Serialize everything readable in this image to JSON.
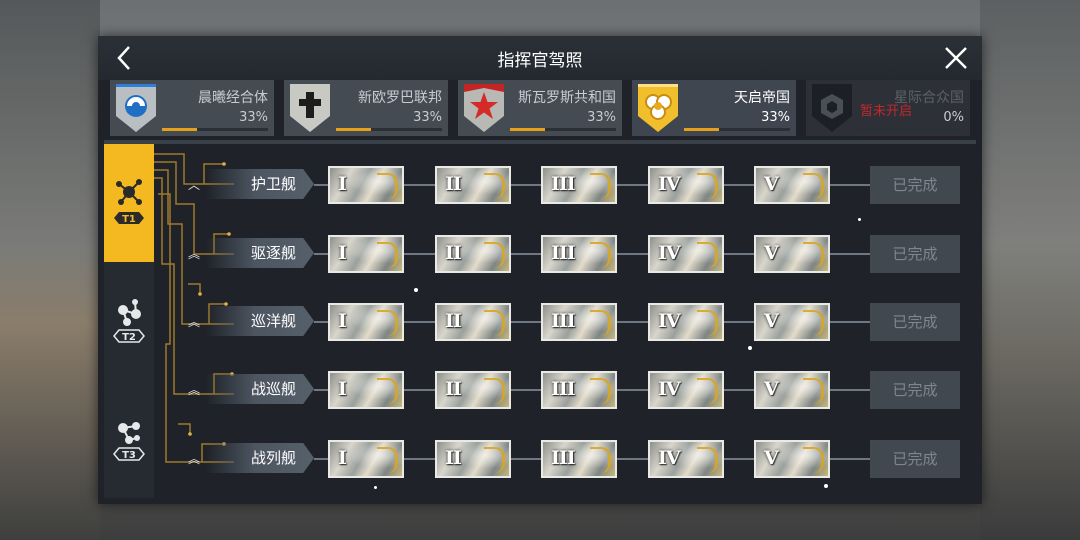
{
  "window": {
    "title": "指挥官驾照"
  },
  "colors": {
    "accent": "#f4b820",
    "progress": "#e5a11a",
    "locked_text": "#c0282b"
  },
  "factions": [
    {
      "name": "晨曦经合体",
      "percent": "33%",
      "progress": 0.33,
      "icon": "dawn-emblem-icon",
      "state": "normal"
    },
    {
      "name": "新欧罗巴联邦",
      "percent": "33%",
      "progress": 0.33,
      "icon": "cross-emblem-icon",
      "state": "normal"
    },
    {
      "name": "斯瓦罗斯共和国",
      "percent": "33%",
      "progress": 0.33,
      "icon": "star-emblem-icon",
      "state": "normal"
    },
    {
      "name": "天启帝国",
      "percent": "33%",
      "progress": 0.33,
      "icon": "hex-emblem-icon",
      "state": "selected"
    },
    {
      "name": "星际合众国",
      "percent": "0%",
      "progress": 0,
      "icon": "cube-emblem-icon",
      "state": "locked",
      "lock_label": "暂未开启"
    }
  ],
  "tiers": [
    {
      "label": "T1",
      "active": true
    },
    {
      "label": "T2",
      "active": false
    },
    {
      "label": "T3",
      "active": false
    }
  ],
  "ship_classes": [
    {
      "label": "护卫舰",
      "chevron": "︿",
      "numerals": [
        "I",
        "II",
        "III",
        "IV",
        "V"
      ],
      "status": "已完成"
    },
    {
      "label": "驱逐舰",
      "chevron": "︽",
      "numerals": [
        "I",
        "II",
        "III",
        "IV",
        "V"
      ],
      "status": "已完成"
    },
    {
      "label": "巡洋舰",
      "chevron": "︽",
      "numerals": [
        "I",
        "II",
        "III",
        "IV",
        "V"
      ],
      "status": "已完成"
    },
    {
      "label": "战巡舰",
      "chevron": "︽",
      "numerals": [
        "I",
        "II",
        "III",
        "IV",
        "V"
      ],
      "status": "已完成"
    },
    {
      "label": "战列舰",
      "chevron": "︽",
      "numerals": [
        "I",
        "II",
        "III",
        "IV",
        "V"
      ],
      "status": "已完成"
    }
  ]
}
